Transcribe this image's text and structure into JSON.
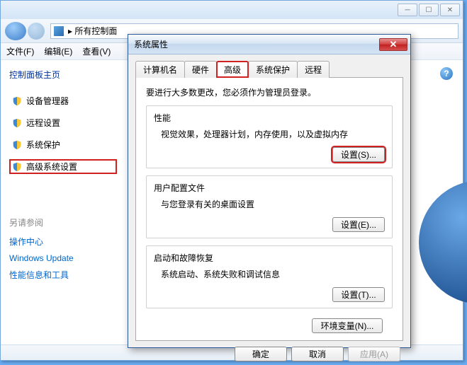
{
  "explorer": {
    "address": "所有控制面",
    "menu": {
      "file": "文件(F)",
      "edit": "编辑(E)",
      "view": "查看(V)"
    },
    "sidebar_title": "控制面板主页",
    "side_items": [
      "设备管理器",
      "远程设置",
      "系统保护",
      "高级系统设置"
    ],
    "seealso_header": "另请参阅",
    "seealso": [
      "操作中心",
      "Windows Update",
      "性能信息和工具"
    ]
  },
  "dialog": {
    "title": "系统属性",
    "tabs": {
      "computer_name": "计算机名",
      "hardware": "硬件",
      "advanced": "高级",
      "sys_protect": "系统保护",
      "remote": "远程"
    },
    "notice": "要进行大多数更改，您必须作为管理员登录。",
    "perf": {
      "title": "性能",
      "desc": "视觉效果，处理器计划，内存使用，以及虚拟内存",
      "btn": "设置(S)..."
    },
    "profile": {
      "title": "用户配置文件",
      "desc": "与您登录有关的桌面设置",
      "btn": "设置(E)..."
    },
    "startup": {
      "title": "启动和故障恢复",
      "desc": "系统启动、系统失败和调试信息",
      "btn": "设置(T)..."
    },
    "envvar_btn": "环境变量(N)...",
    "ok": "确定",
    "cancel": "取消",
    "apply": "应用(A)"
  }
}
